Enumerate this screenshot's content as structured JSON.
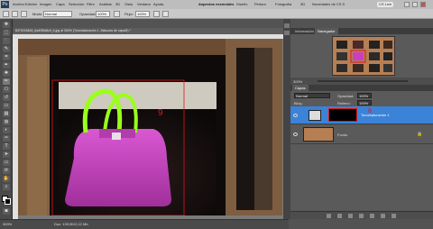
{
  "app": {
    "logo": "Ps"
  },
  "menu": [
    "Archivo",
    "Edición",
    "Imagen",
    "Capa",
    "Selección",
    "Filtro",
    "Análisis",
    "3D",
    "Vista",
    "Ventana",
    "Ayuda"
  ],
  "workspaces": {
    "current": "Aspectos esenciales",
    "items": [
      "Diseño",
      "Pintura",
      "Fotografía",
      "3D",
      "Novedades de CS 5"
    ]
  },
  "cs_live": "CS Live",
  "options": {
    "modo_label": "Modo:",
    "modo_value": "Normal",
    "opacidad_label": "Opacidad:",
    "opacidad_value": "100%",
    "flujo_label": "Flujo:",
    "flujo_value": "100%"
  },
  "document": {
    "tab_title": "8370215843_6a4f35d8c9_b.jpg al 300% (Tono/saturación 1, Máscara de capa/8) *",
    "zoom": "300%",
    "status": "Doc: 139,9K/2,12 Mb"
  },
  "annotations": {
    "canvas_number": "9",
    "layer_number": "8"
  },
  "panels": {
    "tabs_top": [
      "Información",
      "Navegador"
    ],
    "navigator_zoom": "300%",
    "tabs_layers": [
      "Capas"
    ],
    "blend_mode": "Normal",
    "opacity_label": "Opacidad:",
    "opacity_value": "100%",
    "lock_label": "Bloq.:",
    "fill_label": "Relleno:",
    "fill_value": "100%",
    "layers": [
      {
        "name": "Tono/saturación 1"
      },
      {
        "name": "Fondo"
      }
    ]
  },
  "colors": {
    "accent_selection": "#3a83d8",
    "red_annotation": "#e0161a",
    "bag": "#c93fc0",
    "handle": "#9aff1a"
  }
}
